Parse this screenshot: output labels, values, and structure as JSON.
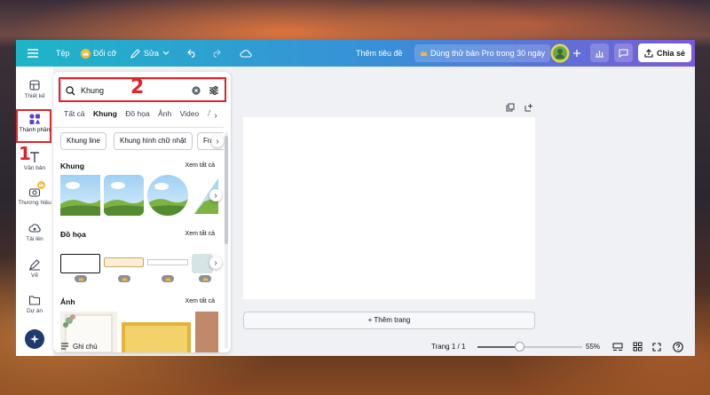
{
  "topbar": {
    "menu_label": "Tệp",
    "resize_label": "Đổi cỡ",
    "edit_label": "Sửa",
    "title_label": "Thêm tiêu đề",
    "pro_trial_label": "Dùng thử bản Pro trong 30 ngày",
    "share_label": "Chia sẻ"
  },
  "rail": {
    "items": [
      {
        "label": "Thiết kế"
      },
      {
        "label": "Thành phần"
      },
      {
        "label": "Văn bản"
      },
      {
        "label": "Thương hiệu"
      },
      {
        "label": "Tải lên"
      },
      {
        "label": "Vẽ"
      },
      {
        "label": "Dự án"
      }
    ]
  },
  "panel": {
    "search_value": "Khung",
    "tabs": [
      "Tất cả",
      "Khung",
      "Đồ họa",
      "Ảnh",
      "Video",
      "Âm"
    ],
    "chips": [
      "Khung line",
      "Khung hình chữ nhật",
      "Fra"
    ],
    "sections": [
      {
        "title": "Khung",
        "see_all": "Xem tất cả"
      },
      {
        "title": "Đồ họa",
        "see_all": "Xem tất cả"
      },
      {
        "title": "Ảnh",
        "see_all": "Xem tất cả"
      }
    ]
  },
  "canvas": {
    "add_page_label": "+ Thêm trang"
  },
  "bottombar": {
    "notes_label": "Ghi chú",
    "page_indicator": "Trang 1 / 1",
    "zoom_label": "55%",
    "zoom_fraction": 0.4
  },
  "annotations": {
    "step1": "1",
    "step2": "2"
  },
  "colors": {
    "annotation_red": "#e0242b",
    "topbar_start": "#1eb5c8",
    "topbar_end": "#7b5ad8"
  }
}
